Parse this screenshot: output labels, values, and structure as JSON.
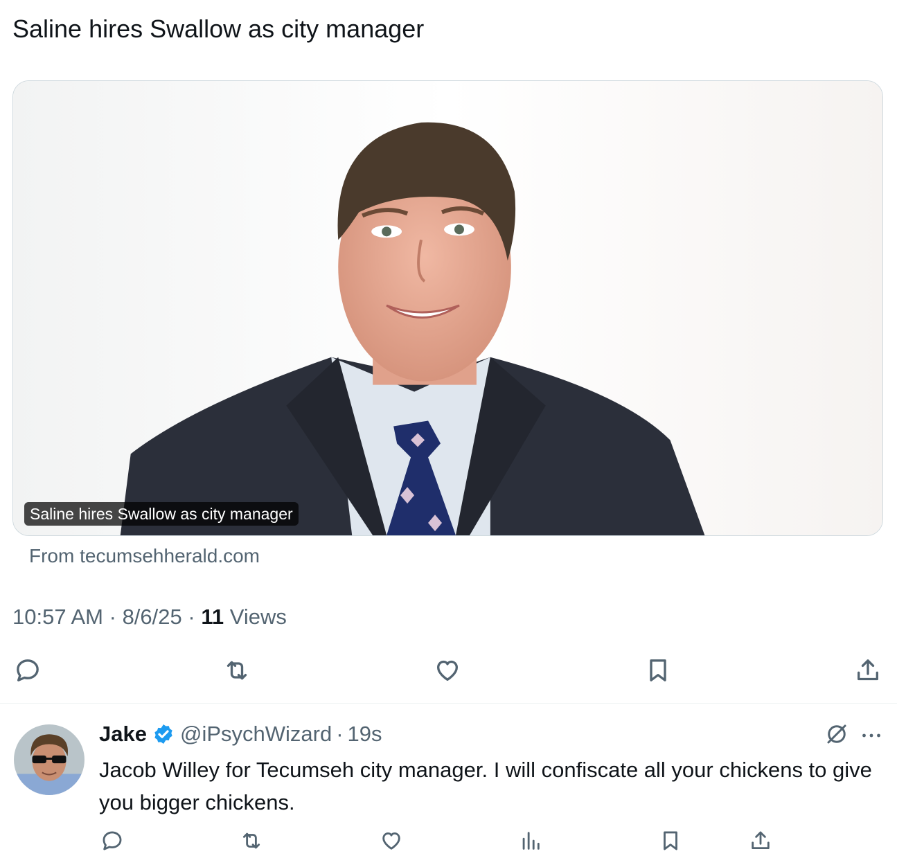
{
  "tweet": {
    "text": "Saline hires Swallow as city manager",
    "card": {
      "caption": "Saline hires Swallow as city manager",
      "source": "From tecumsehherald.com"
    },
    "time": "10:57 AM",
    "date": "8/6/25",
    "separator": "·",
    "views_count": "11",
    "views_label": "Views",
    "actions": [
      "reply-icon",
      "retweet-icon",
      "like-icon",
      "bookmark-icon",
      "share-icon"
    ]
  },
  "reply": {
    "name": "Jake",
    "handle": "@iPsychWizard",
    "separator": "·",
    "time": "19s",
    "text": "Jacob Willey for Tecumseh city manager. I will confiscate all your chickens to give you bigger chickens.",
    "actions": [
      "reply-icon",
      "retweet-icon",
      "like-icon",
      "views-icon",
      "bookmark-icon",
      "share-icon"
    ]
  },
  "colors": {
    "text_primary": "#0f1419",
    "text_secondary": "#536471",
    "verified": "#1d9bf0",
    "border": "#cfd9de"
  }
}
